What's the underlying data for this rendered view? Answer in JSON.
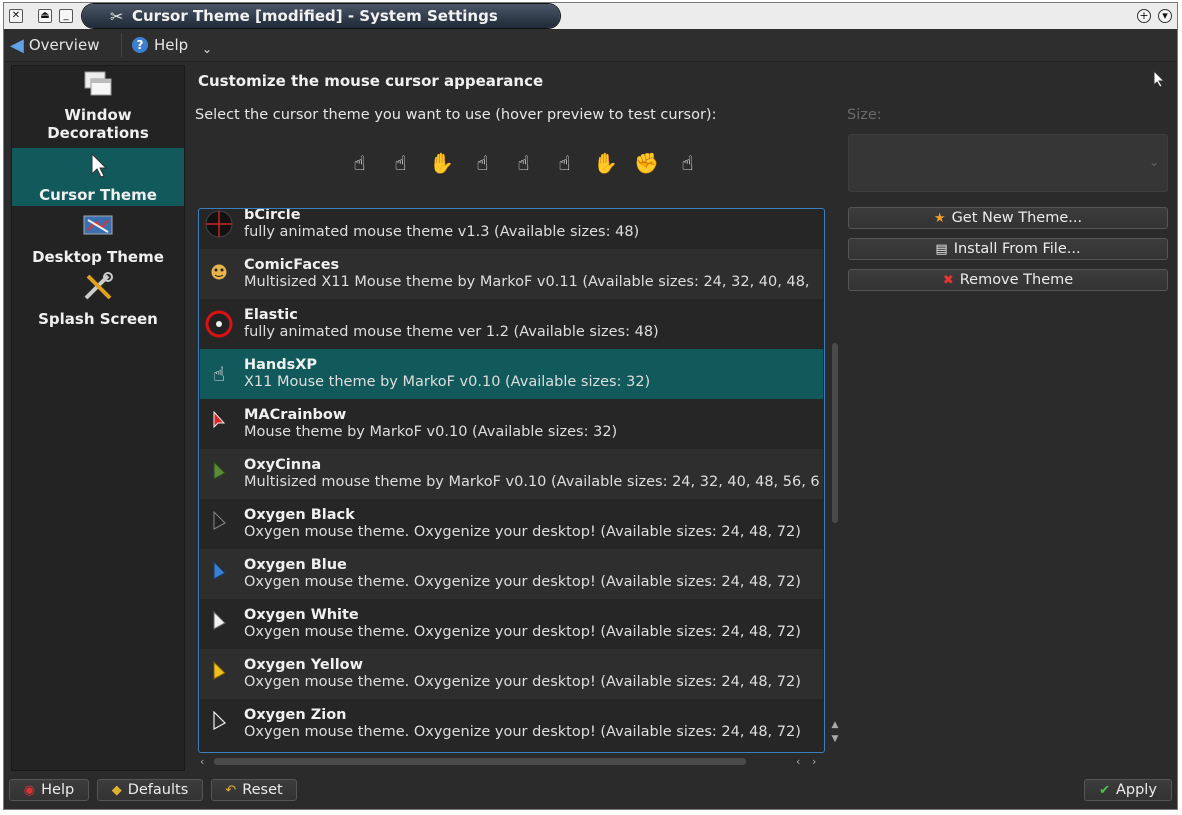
{
  "window": {
    "title": "Cursor Theme [modified] - System Settings",
    "close_glyph": "✕",
    "title_icon": "✂"
  },
  "toolbar": {
    "overview_label": "Overview",
    "help_label": "Help",
    "chevron": "⌄"
  },
  "sidebar": {
    "items": [
      {
        "label": "Window Decorations",
        "icon": "windows-icon"
      },
      {
        "label": "Cursor Theme",
        "icon": "cursor-icon"
      },
      {
        "label": "Desktop Theme",
        "icon": "desktop-icon"
      },
      {
        "label": "Splash Screen",
        "icon": "tools-icon"
      }
    ]
  },
  "main": {
    "heading": "Customize the mouse cursor appearance",
    "instruction": "Select the cursor theme you want to use (hover preview to test cursor):",
    "size_label": "Size:"
  },
  "themes": [
    {
      "name": "bCircle",
      "desc": "fully animated mouse theme v1.3 (Available sizes: 48)",
      "icon": "bcircle-icon"
    },
    {
      "name": "ComicFaces",
      "desc": "Multisized X11 Mouse theme by MarkoF v0.11 (Available sizes: 24, 32, 40, 48,",
      "icon": "comicfaces-icon"
    },
    {
      "name": "Elastic",
      "desc": "fully animated mouse theme ver 1.2 (Available sizes: 48)",
      "icon": "elastic-icon"
    },
    {
      "name": "HandsXP",
      "desc": "X11 Mouse theme by MarkoF v0.10 (Available sizes: 32)",
      "icon": "handsxp-icon"
    },
    {
      "name": "MACrainbow",
      "desc": "Mouse theme by MarkoF v0.10 (Available sizes: 32)",
      "icon": "macrainbow-icon"
    },
    {
      "name": "OxyCinna",
      "desc": "Multisized mouse theme by MarkoF v0.10 (Available sizes: 24, 32, 40, 48, 56, 6",
      "icon": "oxycinna-icon"
    },
    {
      "name": "Oxygen Black",
      "desc": "Oxygen mouse theme. Oxygenize your desktop! (Available sizes: 24, 48, 72)",
      "icon": "oxygen-black-icon"
    },
    {
      "name": "Oxygen Blue",
      "desc": "Oxygen mouse theme. Oxygenize your desktop! (Available sizes: 24, 48, 72)",
      "icon": "oxygen-blue-icon"
    },
    {
      "name": "Oxygen White",
      "desc": "Oxygen mouse theme. Oxygenize your desktop! (Available sizes: 24, 48, 72)",
      "icon": "oxygen-white-icon"
    },
    {
      "name": "Oxygen Yellow",
      "desc": "Oxygen mouse theme. Oxygenize your desktop! (Available sizes: 24, 48, 72)",
      "icon": "oxygen-yellow-icon"
    },
    {
      "name": "Oxygen Zion",
      "desc": "Oxygen mouse theme. Oxygenize your desktop! (Available sizes: 24, 48, 72)",
      "icon": "oxygen-zion-icon"
    }
  ],
  "selected_theme": "HandsXP",
  "actions": {
    "get_new": "Get New Theme...",
    "install": "Install From File...",
    "remove": "Remove Theme"
  },
  "bottom": {
    "help": "Help",
    "defaults": "Defaults",
    "reset": "Reset",
    "apply": "Apply"
  },
  "colors": {
    "selection": "#12595c",
    "focus_border": "#3a7fc1",
    "window_bg": "#2b2b2b"
  }
}
